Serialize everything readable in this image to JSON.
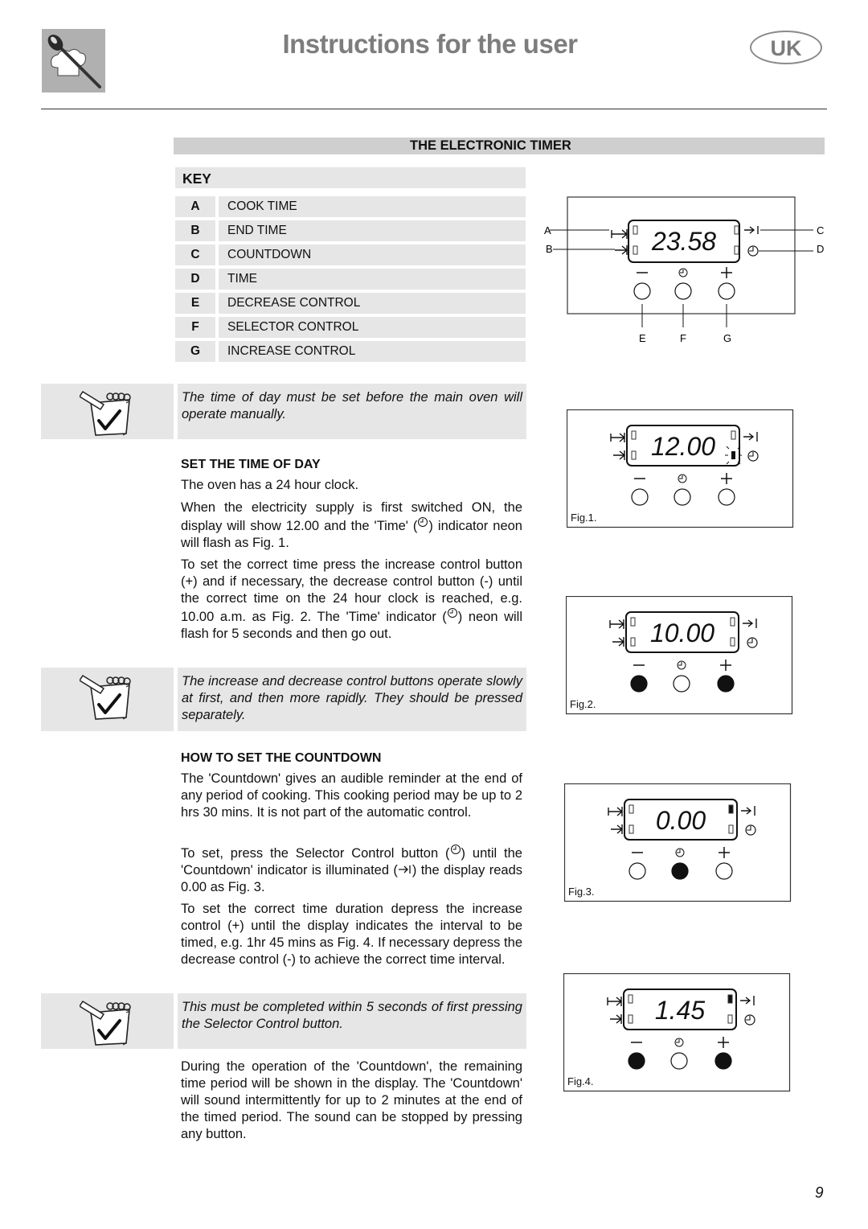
{
  "header": {
    "title": "Instructions for the user",
    "region_badge": "UK",
    "logo_icon": "spoon-and-chef-hat-icon"
  },
  "section": {
    "title": "THE ELECTRONIC TIMER"
  },
  "key": {
    "heading": "KEY",
    "items": [
      {
        "letter": "A",
        "label": "COOK TIME"
      },
      {
        "letter": "B",
        "label": "END TIME"
      },
      {
        "letter": "C",
        "label": "COUNTDOWN"
      },
      {
        "letter": "D",
        "label": "TIME"
      },
      {
        "letter": "E",
        "label": "DECREASE CONTROL"
      },
      {
        "letter": "F",
        "label": "SELECTOR CONTROL"
      },
      {
        "letter": "G",
        "label": "INCREASE CONTROL"
      }
    ]
  },
  "notes": [
    {
      "icon": "notepad-checkmark-icon",
      "text": "The time of day must be set before the main oven will operate manually."
    },
    {
      "icon": "notepad-checkmark-icon",
      "text": "The increase and decrease control buttons operate slowly at first, and then more rapidly. They should be pressed separately."
    },
    {
      "icon": "notepad-checkmark-icon",
      "text": "This must be completed within 5 seconds of first pressing the Selector Control button."
    }
  ],
  "set_time": {
    "heading": "SET THE TIME OF DAY",
    "p1": "The oven has a 24 hour clock.",
    "p2_a": "When the electricity supply is first switched ON, the display will show 12.00 and the 'Time' (",
    "p2_b": ") indicator neon will flash as Fig. 1.",
    "p3_a": "To set the correct time press the increase control button (+) and if necessary, the decrease control button (-) until the correct time on the 24 hour clock is reached, e.g. 10.00 a.m. as Fig. 2. The 'Time' indicator (",
    "p3_b": ") neon will flash for 5 seconds and then go out."
  },
  "countdown": {
    "heading": "HOW TO SET THE COUNTDOWN",
    "p1": "The 'Countdown' gives an audible reminder at the end of any period of cooking. This cooking period may be up to 2 hrs 30 mins. It is not part of the automatic control.",
    "p2_a": "To set, press the Selector Control button (",
    "p2_b": ") until the 'Countdown' indicator is illuminated (",
    "p2_c": ") the display reads 0.00 as Fig. 3.",
    "p3": "To set the correct time duration depress the increase control (+) until the display indicates the interval to be timed, e.g. 1hr 45 mins as Fig. 4. If necessary depress the decrease control (-) to achieve the correct time interval.",
    "p4": "During the operation of the 'Countdown', the remaining time period will be shown in the display. The 'Countdown' will sound intermittently for up to 2 minutes at the end of the timed period. The sound can be stopped by pressing any button."
  },
  "diagrams": {
    "key_diagram": {
      "display": "23.58",
      "callouts": {
        "A": "A",
        "B": "B",
        "C": "C",
        "D": "D",
        "E": "E",
        "F": "F",
        "G": "G"
      },
      "button_symbols": {
        "decrease": "−",
        "increase": "+"
      }
    },
    "figures": [
      {
        "label": "Fig.1.",
        "display": "12.00",
        "time_indicator": "flashing",
        "countdown_indicator": "off",
        "pressed": {
          "decrease": false,
          "selector": false,
          "increase": false
        }
      },
      {
        "label": "Fig.2.",
        "display": "10.00",
        "time_indicator": "off",
        "countdown_indicator": "off",
        "pressed": {
          "decrease": true,
          "selector": false,
          "increase": true
        }
      },
      {
        "label": "Fig.3.",
        "display": "0.00",
        "time_indicator": "off",
        "countdown_indicator": "on",
        "pressed": {
          "decrease": false,
          "selector": true,
          "increase": false
        }
      },
      {
        "label": "Fig.4.",
        "display": "1.45",
        "time_indicator": "off",
        "countdown_indicator": "on",
        "pressed": {
          "decrease": true,
          "selector": false,
          "increase": true
        }
      }
    ]
  },
  "page_number": "9"
}
